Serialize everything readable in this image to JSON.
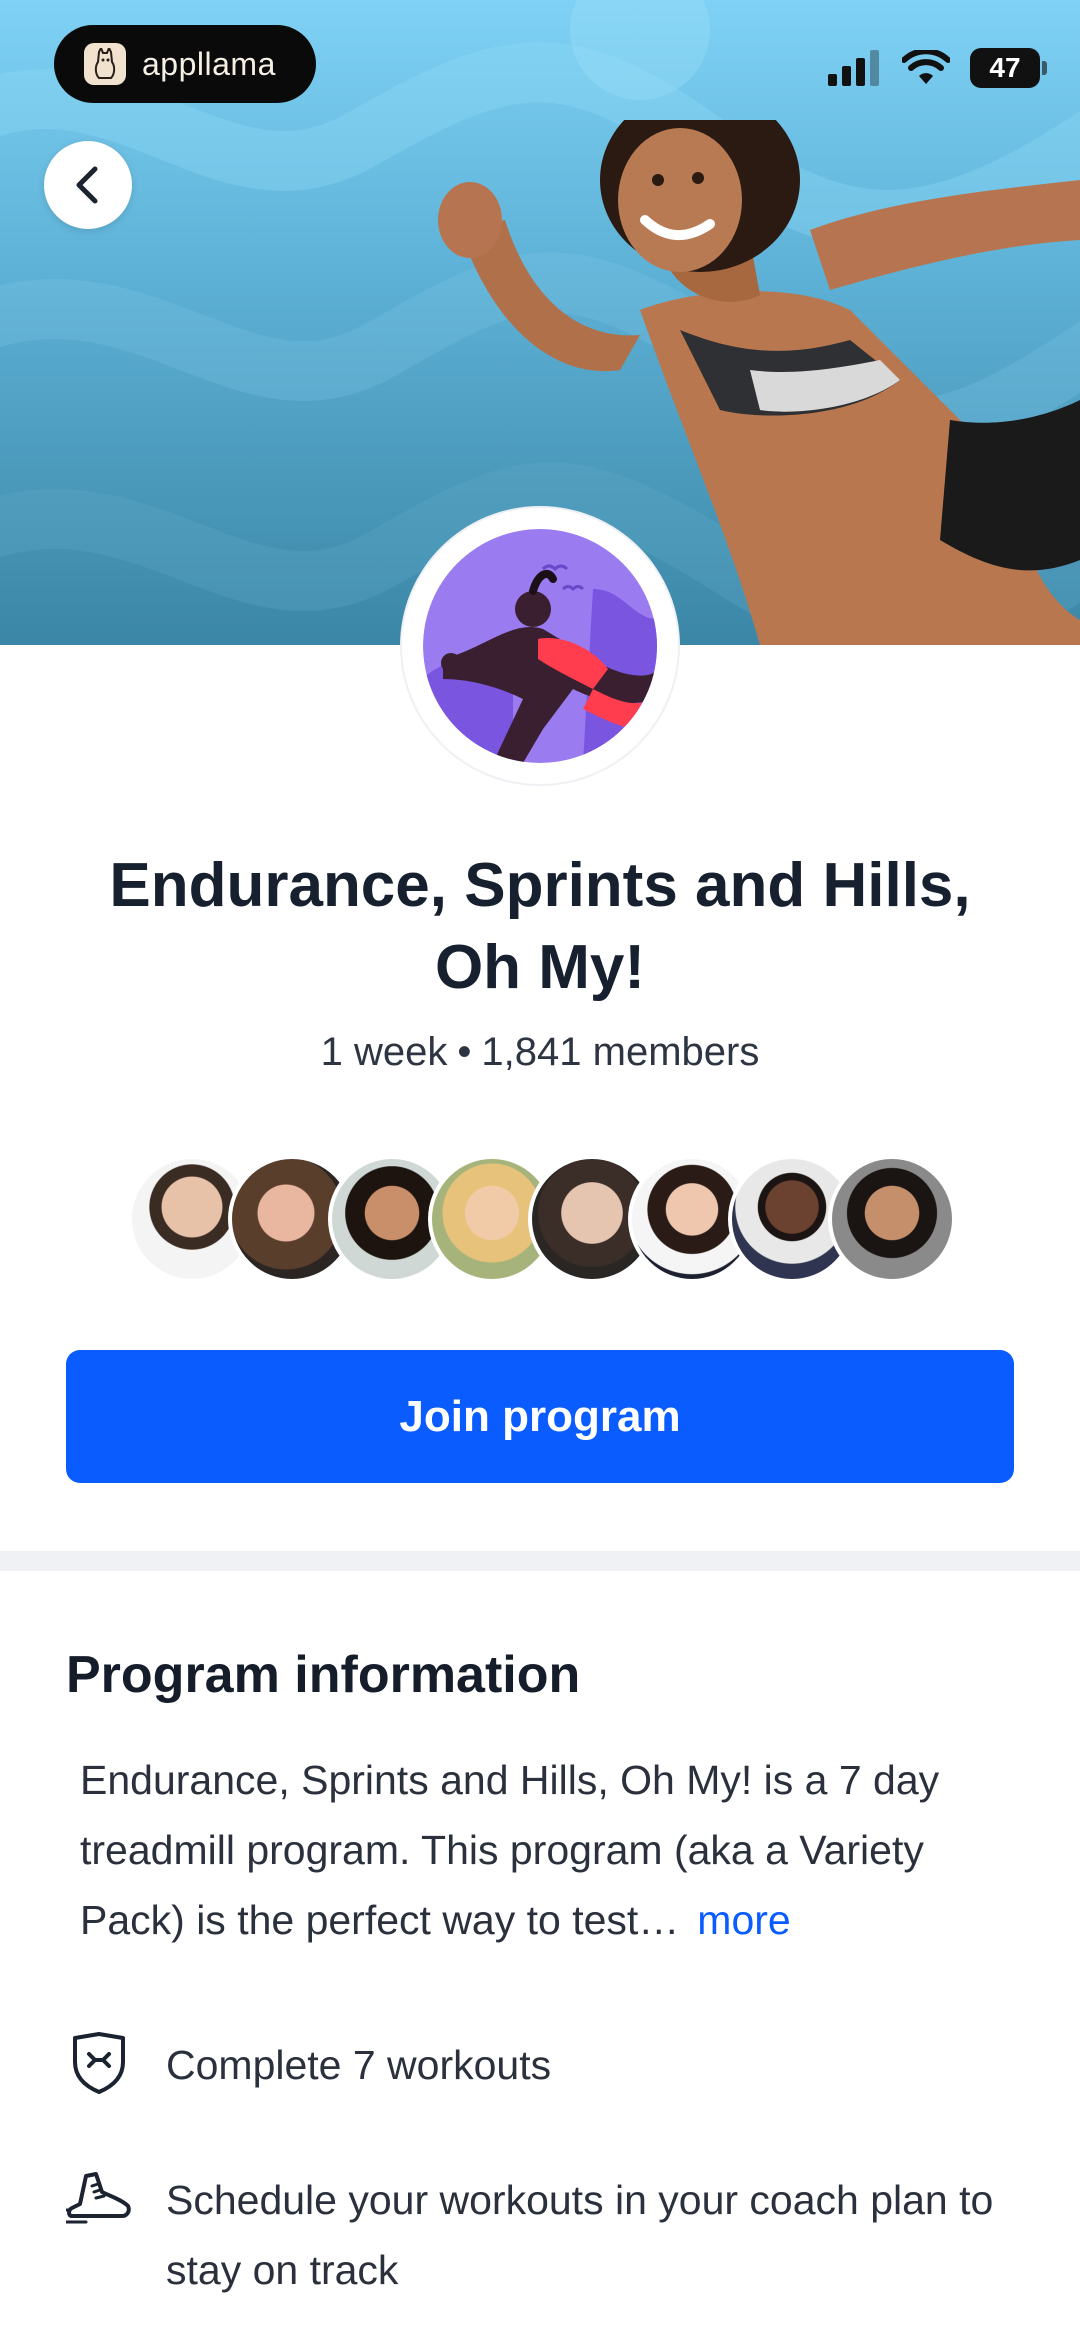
{
  "status_bar": {
    "app_badge_label": "appllama",
    "battery_level": "47"
  },
  "hero": {
    "back_icon": "chevron-left-icon"
  },
  "program": {
    "title": "Endurance, Sprints and Hills, Oh My!",
    "duration": "1 week",
    "separator": "•",
    "members": "1,841 members",
    "member_avatars": [
      "avatar-1",
      "avatar-2",
      "avatar-3",
      "avatar-4",
      "avatar-5",
      "avatar-6",
      "avatar-7",
      "avatar-8"
    ],
    "join_label": "Join program"
  },
  "info": {
    "heading": "Program information",
    "description": "Endurance, Sprints and Hills, Oh My! is a 7 day treadmill program. This program (aka a Variety Pack) is the perfect way to test…",
    "more_label": "more",
    "features": [
      {
        "icon": "shield-icon",
        "text": "Complete 7 workouts"
      },
      {
        "icon": "running-shoe-icon",
        "text": "Schedule your workouts in your coach plan to stay on track"
      }
    ]
  },
  "colors": {
    "primary": "#0a5cff",
    "text_dark": "#17202e",
    "hero_top": "#7fd2f5",
    "hero_bottom": "#3b86a6",
    "badge_purple": "#9b7bf0"
  }
}
